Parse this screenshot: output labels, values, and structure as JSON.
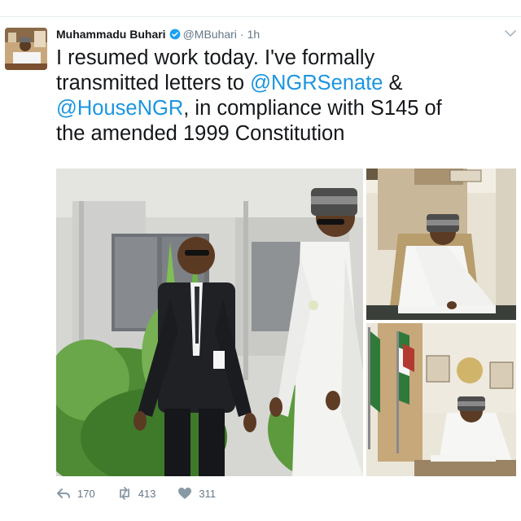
{
  "tweet": {
    "author_name": "Muhammadu Buhari",
    "handle": "@MBuhari",
    "separator": "·",
    "time": "1h",
    "text_lines": [
      [
        {
          "t": "I resumed work today. I've formally",
          "m": false
        }
      ],
      [
        {
          "t": "transmitted letters to ",
          "m": false
        },
        {
          "t": "@NGRSenate",
          "m": true
        },
        {
          "t": " &",
          "m": false
        }
      ],
      [
        {
          "t": "@HouseNGR",
          "m": true
        },
        {
          "t": ", in compliance with S145 of",
          "m": false
        }
      ],
      [
        {
          "t": "the amended 1999 Constitution",
          "m": false
        }
      ]
    ],
    "mention_color": "#1b95e0"
  },
  "actions": {
    "reply_count": "170",
    "retweet_count": "413",
    "like_count": "311"
  },
  "icons": {
    "verified": "verified-badge-icon",
    "menu": "chevron-down-icon",
    "reply": "reply-icon",
    "retweet": "retweet-icon",
    "like": "heart-icon"
  },
  "colors": {
    "accent": "#1da1f2",
    "muted": "#657786",
    "text": "#14171a"
  }
}
